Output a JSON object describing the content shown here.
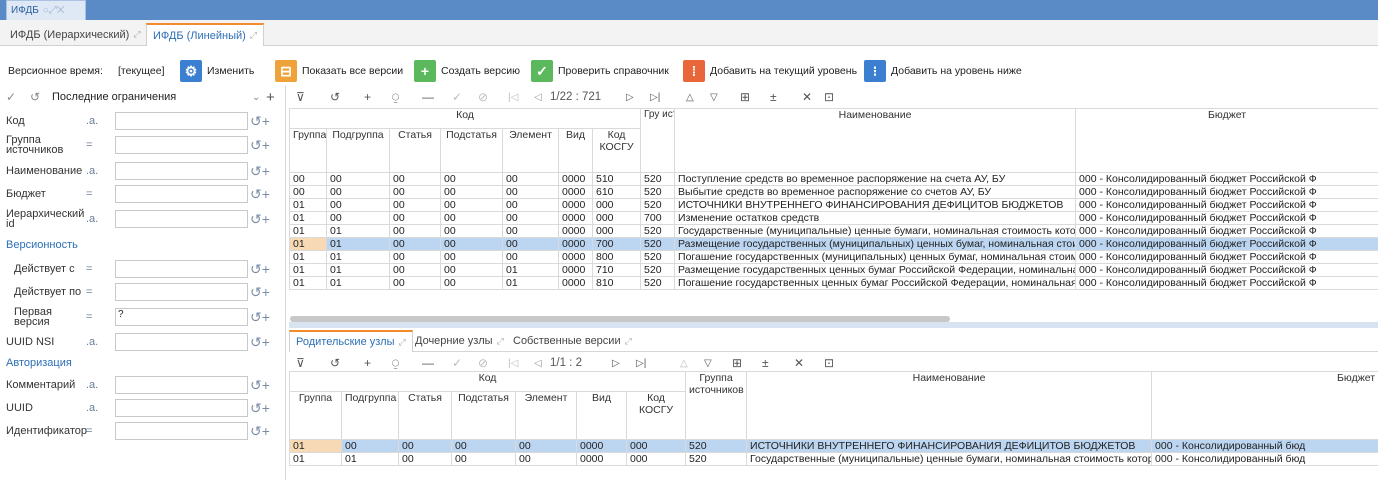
{
  "app_tab": {
    "title": "ИФДБ"
  },
  "tabs": [
    {
      "label": "ИФДБ (Иерархический)",
      "active": false
    },
    {
      "label": "ИФДБ (Линейный)",
      "active": true
    }
  ],
  "toolbar": {
    "version_time_label": "Версионное время:",
    "version_time_value": "[текущее]",
    "change_label": "Изменить",
    "show_all_label": "Показать все версии",
    "create_label": "Создать версию",
    "check_label": "Проверить справочник",
    "add_current_label": "Добавить на текущий уровень",
    "add_below_label": "Добавить на уровень ниже"
  },
  "filter": {
    "limits": "Последние ограничения",
    "rows": [
      {
        "label": "Код",
        "op": ".a."
      },
      {
        "label": "Группа источников",
        "op": "="
      },
      {
        "label": "Наименование",
        "op": ".a."
      },
      {
        "label": "Бюджет",
        "op": "="
      },
      {
        "label": "Иерархический id",
        "op": ".a."
      }
    ],
    "section_versioning": "Версионность",
    "versioning_rows": [
      {
        "label": "Действует с",
        "op": "="
      },
      {
        "label": "Действует по",
        "op": "="
      },
      {
        "label": "Первая версия",
        "op": "=",
        "value": "?"
      },
      {
        "label": "UUID NSI",
        "op": ".a."
      }
    ],
    "section_auth": "Авторизация",
    "auth_rows": [
      {
        "label": "Комментарий",
        "op": ".a."
      },
      {
        "label": "UUID",
        "op": ".a."
      },
      {
        "label": "Идентификатор",
        "op": "="
      }
    ]
  },
  "grid1": {
    "pager": "1/22 : 721",
    "group_header": "Код",
    "group_src_short": "Гру источ",
    "columns": [
      "Группа",
      "Подгруппа",
      "Статья",
      "Подстатья",
      "Элемент",
      "Вид",
      "Код КОСГУ",
      "",
      "Наименование",
      "Бюджет"
    ],
    "rows": [
      [
        "00",
        "00",
        "00",
        "00",
        "00",
        "0000",
        "510",
        "520",
        "Поступление средств во временное распоряжение на счета АУ, БУ",
        "000 - Консолидированный бюджет Российской Ф"
      ],
      [
        "00",
        "00",
        "00",
        "00",
        "00",
        "0000",
        "610",
        "520",
        "Выбытие средств во временное распоряжение со счетов АУ, БУ",
        "000 - Консолидированный бюджет Российской Ф"
      ],
      [
        "01",
        "00",
        "00",
        "00",
        "00",
        "0000",
        "000",
        "520",
        "ИСТОЧНИКИ ВНУТРЕННЕГО ФИНАНСИРОВАНИЯ ДЕФИЦИТОВ БЮДЖЕТОВ",
        "000 - Консолидированный бюджет Российской Ф"
      ],
      [
        "01",
        "00",
        "00",
        "00",
        "00",
        "0000",
        "000",
        "700",
        "Изменение остатков средств",
        "000 - Консолидированный бюджет Российской Ф"
      ],
      [
        "01",
        "01",
        "00",
        "00",
        "00",
        "0000",
        "000",
        "520",
        "Государственные (муниципальные) ценные бумаги, номинальная стоимость которі",
        "000 - Консолидированный бюджет Российской Ф"
      ],
      [
        "01",
        "01",
        "00",
        "00",
        "00",
        "0000",
        "700",
        "520",
        "Размещение государственных (муниципальных) ценных бумаг, номинальная стоим",
        "000 - Консолидированный бюджет Российской Ф"
      ],
      [
        "01",
        "01",
        "00",
        "00",
        "00",
        "0000",
        "800",
        "520",
        "Погашение государственных (муниципальных) ценных бумаг, номинальная стоимс",
        "000 - Консолидированный бюджет Российской Ф"
      ],
      [
        "01",
        "01",
        "00",
        "00",
        "01",
        "0000",
        "710",
        "520",
        "Размещение государственных ценных бумаг Российской Федерации, номинальная",
        "000 - Консолидированный бюджет Российской Ф"
      ],
      [
        "01",
        "01",
        "00",
        "00",
        "01",
        "0000",
        "810",
        "520",
        "Погашение государственных ценных бумаг Российской Федерации, номинальная с",
        "000 - Консолидированный бюджет Российской Ф"
      ]
    ],
    "selected_row": 5
  },
  "lower_tabs": [
    {
      "label": "Родительские узлы",
      "active": true
    },
    {
      "label": "Дочерние узлы",
      "active": false
    },
    {
      "label": "Собственные версии",
      "active": false
    }
  ],
  "grid2": {
    "pager": "1/1 : 2",
    "group_header": "Код",
    "columns": [
      "Группа",
      "Подгруппа",
      "Статья",
      "Подстатья",
      "Элемент",
      "Вид",
      "Код КОСГУ",
      "Группа источников",
      "Наименование",
      "Бюджет"
    ],
    "rows": [
      [
        "01",
        "00",
        "00",
        "00",
        "00",
        "0000",
        "000",
        "520",
        "ИСТОЧНИКИ ВНУТРЕННЕГО ФИНАНСИРОВАНИЯ ДЕФИЦИТОВ БЮДЖЕТОВ",
        "000 - Консолидированный бюд"
      ],
      [
        "01",
        "01",
        "00",
        "00",
        "00",
        "0000",
        "000",
        "520",
        "Государственные (муниципальные) ценные бумаги, номинальная стоимость которі",
        "000 - Консолидированный бюд"
      ]
    ],
    "selected_row": 0
  },
  "colors": {
    "accent": "#f28b2c",
    "header_blue": "#5a8bc6",
    "selection": "#bcd6f2"
  }
}
